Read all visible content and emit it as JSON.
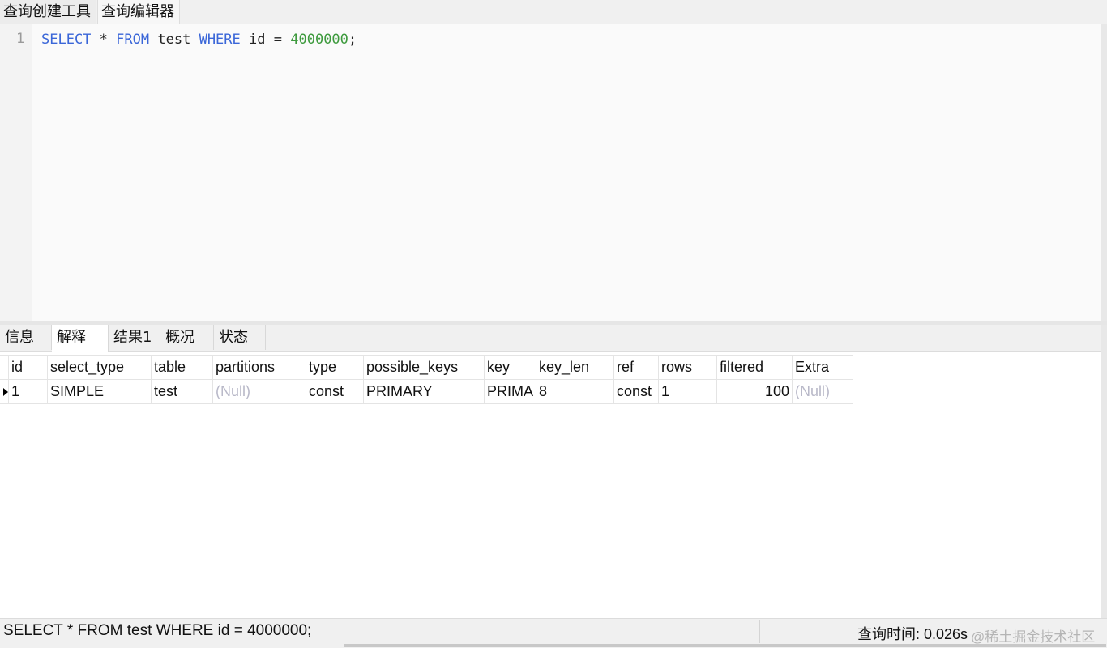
{
  "top_tabs": [
    "查询创建工具",
    "查询编辑器"
  ],
  "editor": {
    "line_number": "1",
    "tokens": {
      "select": "SELECT",
      "star": "*",
      "from": "FROM",
      "table": "test",
      "where": "WHERE",
      "col": "id",
      "eq": "=",
      "value": "4000000",
      "semi": ";"
    }
  },
  "result_tabs": [
    "信息",
    "解释",
    "结果1",
    "概况",
    "状态"
  ],
  "active_result_tab": "解释",
  "grid": {
    "columns": [
      "id",
      "select_type",
      "table",
      "partitions",
      "type",
      "possible_keys",
      "key",
      "key_len",
      "ref",
      "rows",
      "filtered",
      "Extra"
    ],
    "rows": [
      {
        "id": "1",
        "select_type": "SIMPLE",
        "table": "test",
        "partitions": "(Null)",
        "type": "const",
        "possible_keys": "PRIMARY",
        "key": "PRIMA",
        "key_len": "8",
        "ref": "const",
        "rows": "1",
        "filtered": "100",
        "Extra": "(Null)"
      }
    ]
  },
  "status": {
    "sql": "SELECT * FROM test WHERE id = 4000000;",
    "query_time": "查询时间: 0.026s",
    "watermark": "@稀土掘金技术社区"
  },
  "colors": {
    "keyword": "#3a66d8",
    "number": "#3d9a3d",
    "null": "#b8b8c8"
  }
}
